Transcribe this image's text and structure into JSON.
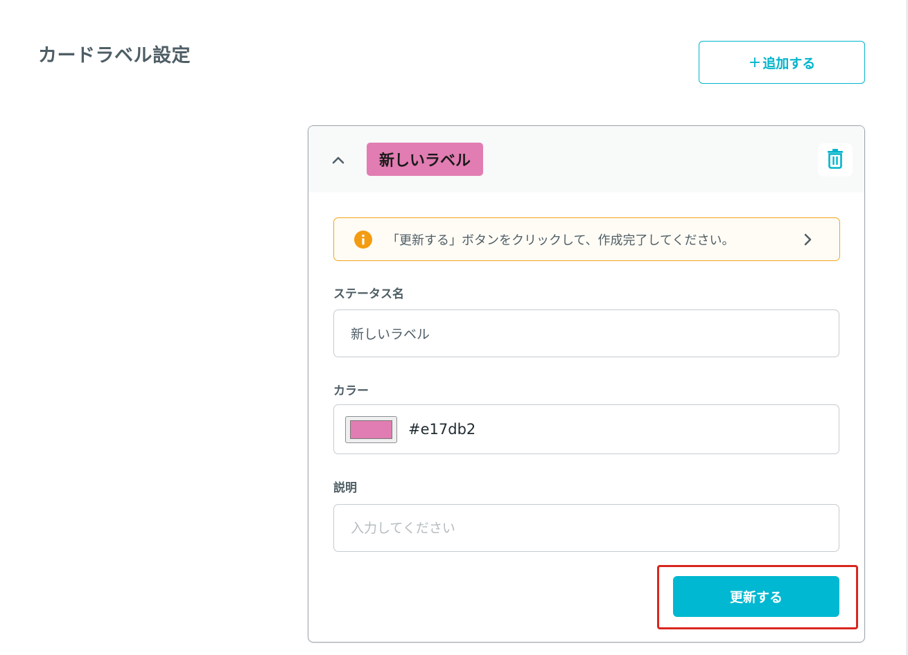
{
  "page": {
    "title": "カードラベル設定",
    "add_button": {
      "plus": "+",
      "label": "追加する"
    }
  },
  "card": {
    "label_chip_text": "新しいラベル",
    "label_chip_color": "#e17db2",
    "notice": {
      "text": "「更新する」ボタンをクリックして、作成完了してください。",
      "icon": "info-icon",
      "border_color": "#f0a51a"
    },
    "fields": {
      "status_name": {
        "label": "ステータス名",
        "value": "新しいラベル"
      },
      "color": {
        "label": "カラー",
        "value": "#e17db2"
      },
      "description": {
        "label": "説明",
        "value": "",
        "placeholder": "入力してください"
      }
    },
    "submit_button": {
      "label": "更新する"
    }
  },
  "colors": {
    "accent": "#00b8d1",
    "highlight": "#d8261e",
    "text": "#4f5e66"
  },
  "icons": [
    "chevron-up-icon",
    "trash-icon",
    "info-icon",
    "chevron-right-icon"
  ]
}
